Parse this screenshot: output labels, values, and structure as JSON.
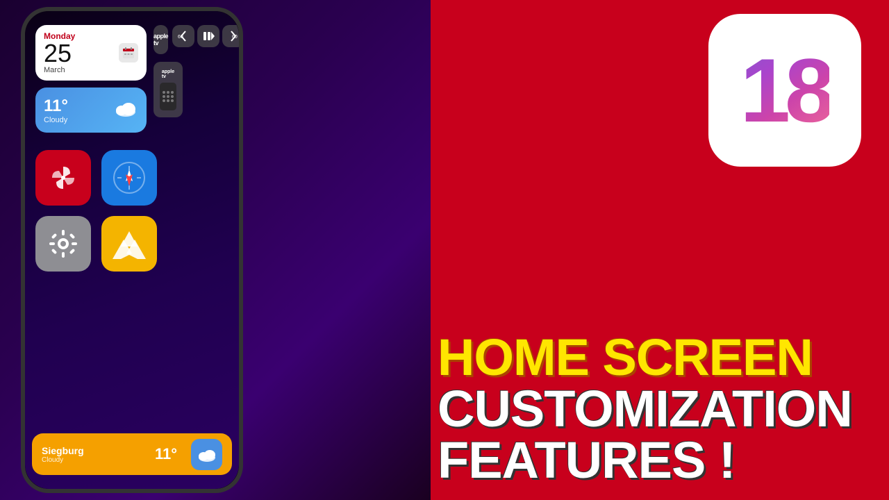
{
  "background": {
    "left_color": "#1a0030",
    "right_color": "#c8001c"
  },
  "phone": {
    "date_widget": {
      "day_name": "Monday",
      "day_number": "25",
      "month": "March"
    },
    "weather_widget": {
      "temperature": "11°",
      "description": "Cloudy"
    },
    "appletv": {
      "logo": "tv",
      "skip_back": "↩60",
      "play_pause": "⏯",
      "skip_forward": "60↪"
    },
    "apps": [
      {
        "name": "Pinwheel",
        "type": "pinwheel"
      },
      {
        "name": "Safari",
        "type": "safari"
      },
      {
        "name": "Settings",
        "type": "settings"
      },
      {
        "name": "Google Drive",
        "type": "drive"
      }
    ],
    "bottom_bar": {
      "city": "Siegburg",
      "description": "Cloudy",
      "temperature": "11°"
    }
  },
  "ios18_badge": {
    "number": "18"
  },
  "title": {
    "line1": "HOME SCREEN",
    "line2": "CUSTOMIZATION",
    "line3": "FEATURES !"
  }
}
